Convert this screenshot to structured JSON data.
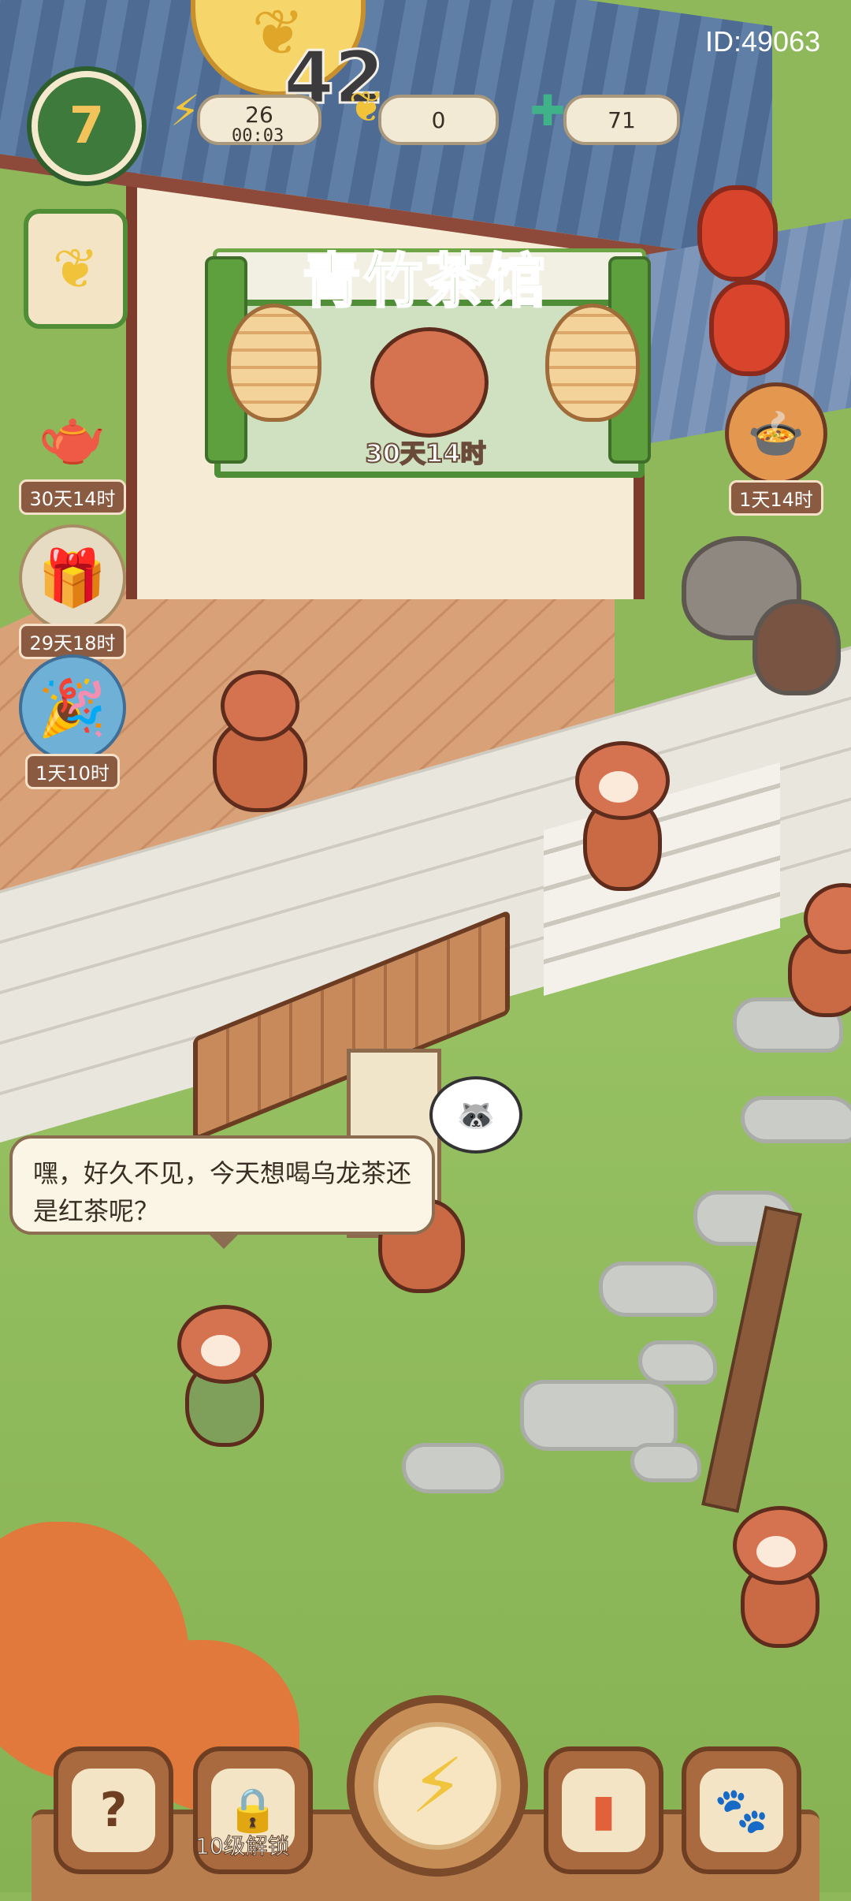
{
  "hud": {
    "level": "7",
    "energy": {
      "value": "26",
      "timer": "00:03"
    },
    "leaf_currency": {
      "value": "0"
    },
    "gem_currency": {
      "value": "71"
    },
    "top_count": "42",
    "user_id": "ID:49063"
  },
  "events_left": [
    {
      "name": "golden-teapot",
      "timer": "30天14时"
    },
    {
      "name": "gift-bundle",
      "timer": "29天18时"
    },
    {
      "name": "panda-party",
      "timer": "1天10时"
    }
  ],
  "featured_banner": {
    "title": "青竹茶馆",
    "timer": "30天14时"
  },
  "food_event": {
    "timer": "1天14时"
  },
  "dialogue": {
    "text": "嘿，好久不见，今天想喝乌龙茶还是红茶呢？"
  },
  "bottom_bar": {
    "help_label": "?",
    "locked_label": "10级解锁"
  },
  "colors": {
    "grass": "#8fb85a",
    "banner_green": "#65a63f",
    "wood": "#a96a40",
    "timer_bg": "#8a5a41"
  }
}
